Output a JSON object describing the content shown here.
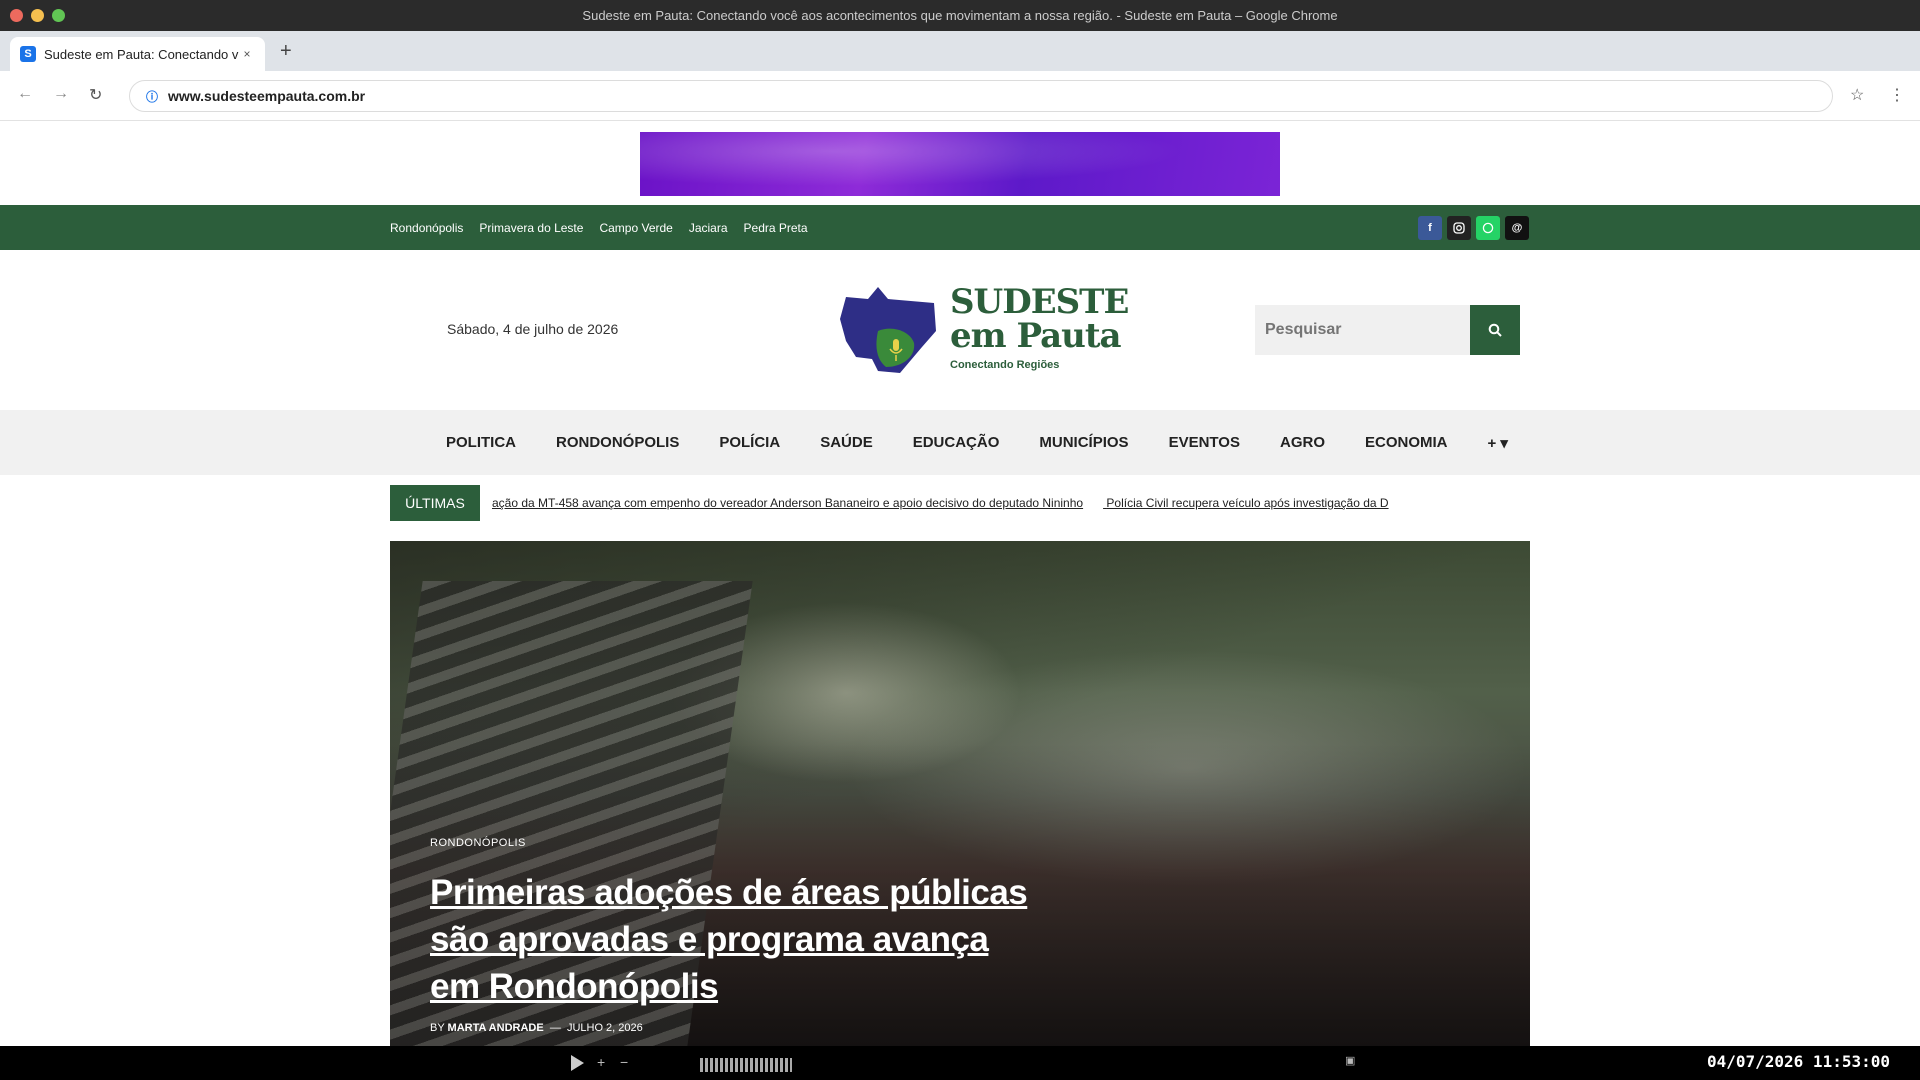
{
  "window": {
    "title": "Sudeste em Pauta: Conectando você aos acontecimentos que movimentam a nossa região. - Sudeste em Pauta – Google Chrome"
  },
  "tab": {
    "favicon": "S",
    "title": "Sudeste em Pauta: Conectando v…",
    "close": "×",
    "new_tab": "+"
  },
  "address_bar": {
    "url": "www.sudesteempauta.com.br"
  },
  "icons": {
    "back": "←",
    "forward": "→",
    "reload": "↻",
    "bookmark": "☆",
    "menu": "⋮",
    "search": "⚲",
    "secure": "ⓘ"
  },
  "top_bar": {
    "cities": [
      "Rondonópolis",
      "Primavera do Leste",
      "Campo Verde",
      "Jaciara",
      "Pedra Preta"
    ],
    "social": [
      "facebook-icon",
      "instagram-icon",
      "whatsapp-icon",
      "threads-icon"
    ]
  },
  "header": {
    "date": "Sábado, 4 de julho de 2026",
    "logo_line1": "SUDESTE",
    "logo_line2": "em Pauta",
    "logo_tagline": "Conectando Regiões",
    "search_placeholder": "Pesquisar"
  },
  "nav": {
    "items": [
      "POLITICA",
      "RONDONÓPOLIS",
      "POLÍCIA",
      "SAÚDE",
      "EDUCAÇÃO",
      "MUNICÍPIOS",
      "EVENTOS",
      "AGRO",
      "ECONOMIA"
    ],
    "more": "+ ▾"
  },
  "ticker": {
    "label": "ÚLTIMAS",
    "items": [
      "ação da MT-458 avança com empenho do vereador Anderson Bananeiro e apoio decisivo do deputado Nininho",
      "Polícia Civil recupera veículo após investigação da D"
    ]
  },
  "hero": {
    "category": "RONDONÓPOLIS",
    "title": "Primeiras adoções de áreas públicas são aprovadas e programa avança em Rondonópolis",
    "by": "BY",
    "author": "MARTA ANDRADE",
    "separator": "—",
    "date": "JULHO 2, 2026"
  },
  "player": {
    "clock": "04/07/2026 11:53:00"
  }
}
